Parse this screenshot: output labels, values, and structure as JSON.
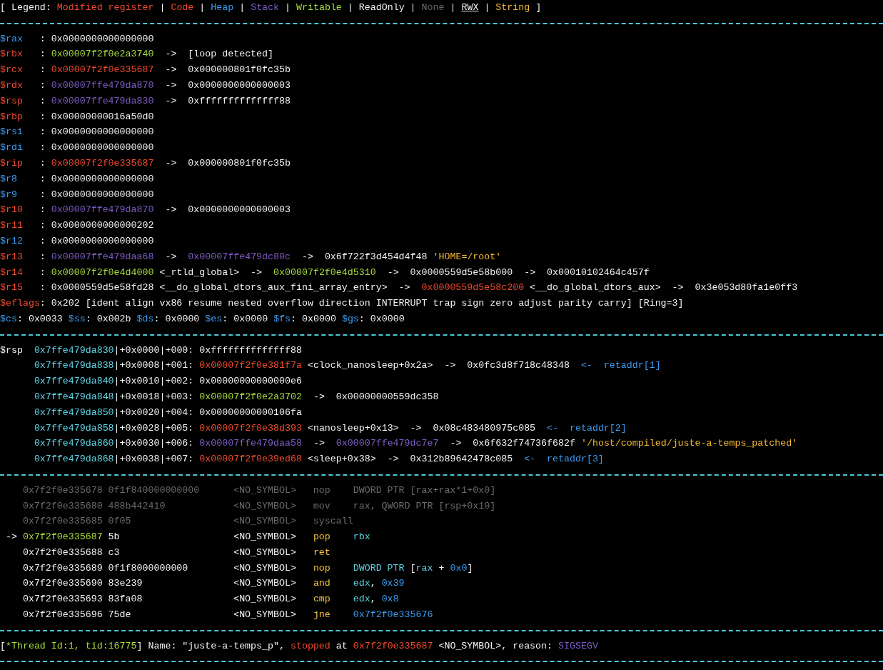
{
  "terminal": {
    "lines": [
      {
        "kind": "text",
        "segments": [
          {
            "kind": "plain",
            "text": "[ Legend: "
          },
          {
            "kind": "modified",
            "text": "Modified register"
          },
          {
            "kind": "plain",
            "text": " | "
          },
          {
            "kind": "code",
            "text": "Code"
          },
          {
            "kind": "plain",
            "text": " | "
          },
          {
            "kind": "heap",
            "text": "Heap"
          },
          {
            "kind": "plain",
            "text": " | "
          },
          {
            "kind": "stack",
            "text": "Stack"
          },
          {
            "kind": "plain",
            "text": " | "
          },
          {
            "kind": "writable",
            "text": "Writable"
          },
          {
            "kind": "plain",
            "text": " | ReadOnly | "
          },
          {
            "kind": "none",
            "text": "None"
          },
          {
            "kind": "plain",
            "text": " | "
          },
          {
            "kind": "rwx",
            "text": "RWX"
          },
          {
            "kind": "plain",
            "text": " | "
          },
          {
            "kind": "string",
            "text": "String"
          },
          {
            "kind": "plain",
            "text": " ]"
          }
        ]
      },
      {
        "kind": "separator"
      },
      {
        "kind": "text",
        "segments": [
          {
            "kind": "heap",
            "text": "$rax"
          },
          {
            "kind": "plain",
            "text": "   : 0x0000000000000000"
          }
        ]
      },
      {
        "kind": "text",
        "segments": [
          {
            "kind": "modified",
            "text": "$rbx"
          },
          {
            "kind": "plain",
            "text": "   : "
          },
          {
            "kind": "writable",
            "text": "0x00007f2f0e2a3740"
          },
          {
            "kind": "plain",
            "text": "  ->  [loop detected]"
          }
        ]
      },
      {
        "kind": "text",
        "segments": [
          {
            "kind": "modified",
            "text": "$rcx"
          },
          {
            "kind": "plain",
            "text": "   : "
          },
          {
            "kind": "code",
            "text": "0x00007f2f0e335687"
          },
          {
            "kind": "plain",
            "text": "  ->  0x000000801f0fc35b"
          }
        ]
      },
      {
        "kind": "text",
        "segments": [
          {
            "kind": "modified",
            "text": "$rdx"
          },
          {
            "kind": "plain",
            "text": "   : "
          },
          {
            "kind": "stack",
            "text": "0x00007ffe479da870"
          },
          {
            "kind": "plain",
            "text": "  ->  0x0000000000000003"
          }
        ]
      },
      {
        "kind": "text",
        "segments": [
          {
            "kind": "modified",
            "text": "$rsp"
          },
          {
            "kind": "plain",
            "text": "   : "
          },
          {
            "kind": "stack",
            "text": "0x00007ffe479da830"
          },
          {
            "kind": "plain",
            "text": "  ->  0xffffffffffffff88"
          }
        ]
      },
      {
        "kind": "text",
        "segments": [
          {
            "kind": "modified",
            "text": "$rbp"
          },
          {
            "kind": "plain",
            "text": "   : 0x00000000016a50d0"
          }
        ]
      },
      {
        "kind": "text",
        "segments": [
          {
            "kind": "heap",
            "text": "$rsi"
          },
          {
            "kind": "plain",
            "text": "   : 0x0000000000000000"
          }
        ]
      },
      {
        "kind": "text",
        "segments": [
          {
            "kind": "heap",
            "text": "$rdi"
          },
          {
            "kind": "plain",
            "text": "   : 0x0000000000000000"
          }
        ]
      },
      {
        "kind": "text",
        "segments": [
          {
            "kind": "modified",
            "text": "$rip"
          },
          {
            "kind": "plain",
            "text": "   : "
          },
          {
            "kind": "code",
            "text": "0x00007f2f0e335687"
          },
          {
            "kind": "plain",
            "text": "  ->  0x000000801f0fc35b"
          }
        ]
      },
      {
        "kind": "text",
        "segments": [
          {
            "kind": "heap",
            "text": "$r8"
          },
          {
            "kind": "plain",
            "text": "    : 0x0000000000000000"
          }
        ]
      },
      {
        "kind": "text",
        "segments": [
          {
            "kind": "heap",
            "text": "$r9"
          },
          {
            "kind": "plain",
            "text": "    : 0x0000000000000000"
          }
        ]
      },
      {
        "kind": "text",
        "segments": [
          {
            "kind": "modified",
            "text": "$r10"
          },
          {
            "kind": "plain",
            "text": "   : "
          },
          {
            "kind": "stack",
            "text": "0x00007ffe479da870"
          },
          {
            "kind": "plain",
            "text": "  ->  0x0000000000000003"
          }
        ]
      },
      {
        "kind": "text",
        "segments": [
          {
            "kind": "modified",
            "text": "$r11"
          },
          {
            "kind": "plain",
            "text": "   : 0x0000000000000202"
          }
        ]
      },
      {
        "kind": "text",
        "segments": [
          {
            "kind": "heap",
            "text": "$r12"
          },
          {
            "kind": "plain",
            "text": "   : 0x0000000000000000"
          }
        ]
      },
      {
        "kind": "text",
        "segments": [
          {
            "kind": "modified",
            "text": "$r13"
          },
          {
            "kind": "plain",
            "text": "   : "
          },
          {
            "kind": "stack",
            "text": "0x00007ffe479daa68"
          },
          {
            "kind": "plain",
            "text": "  ->  "
          },
          {
            "kind": "stack",
            "text": "0x00007ffe479dc80c"
          },
          {
            "kind": "plain",
            "text": "  ->  0x6f722f3d454d4f48 "
          },
          {
            "kind": "string",
            "text": "'HOME=/root'"
          }
        ]
      },
      {
        "kind": "text",
        "segments": [
          {
            "kind": "modified",
            "text": "$r14"
          },
          {
            "kind": "plain",
            "text": "   : "
          },
          {
            "kind": "writable",
            "text": "0x00007f2f0e4d4000"
          },
          {
            "kind": "plain",
            "text": " <_rtld_global>  ->  "
          },
          {
            "kind": "writable",
            "text": "0x00007f2f0e4d5310"
          },
          {
            "kind": "plain",
            "text": "  ->  0x0000559d5e58b000  ->  0x00010102464c457f"
          }
        ]
      },
      {
        "kind": "text",
        "segments": [
          {
            "kind": "modified",
            "text": "$r15"
          },
          {
            "kind": "plain",
            "text": "   : 0x0000559d5e58fd28 <__do_global_dtors_aux_fini_array_entry>  ->  "
          },
          {
            "kind": "code",
            "text": "0x0000559d5e58c200"
          },
          {
            "kind": "plain",
            "text": " <__do_global_dtors_aux>  ->  0x3e053d80fa1e0ff3"
          }
        ]
      },
      {
        "kind": "text",
        "segments": [
          {
            "kind": "modified",
            "text": "$eflags"
          },
          {
            "kind": "plain",
            "text": ": 0x202 [ident align vx86 resume nested overflow direction INTERRUPT trap sign zero adjust parity carry] [Ring=3]"
          }
        ]
      },
      {
        "kind": "text",
        "segments": [
          {
            "kind": "heap",
            "text": "$cs"
          },
          {
            "kind": "plain",
            "text": ": 0x0033 "
          },
          {
            "kind": "heap",
            "text": "$ss"
          },
          {
            "kind": "plain",
            "text": ": 0x002b "
          },
          {
            "kind": "heap",
            "text": "$ds"
          },
          {
            "kind": "plain",
            "text": ": 0x0000 "
          },
          {
            "kind": "heap",
            "text": "$es"
          },
          {
            "kind": "plain",
            "text": ": 0x0000 "
          },
          {
            "kind": "heap",
            "text": "$fs"
          },
          {
            "kind": "plain",
            "text": ": 0x0000 "
          },
          {
            "kind": "heap",
            "text": "$gs"
          },
          {
            "kind": "plain",
            "text": ": 0x0000"
          }
        ]
      },
      {
        "kind": "separator"
      },
      {
        "kind": "text",
        "segments": [
          {
            "kind": "plain",
            "text": "$rsp  "
          },
          {
            "kind": "address",
            "text": "0x7ffe479da830"
          },
          {
            "kind": "plain",
            "text": "|+0x0000|+000: 0xffffffffffffff88"
          }
        ]
      },
      {
        "kind": "stack_row",
        "segments": [
          {
            "kind": "address",
            "text": "0x7ffe479da838"
          },
          {
            "kind": "plain",
            "text": "|+0x0008|+001: "
          },
          {
            "kind": "code",
            "text": "0x00007f2f0e381f7a"
          },
          {
            "kind": "plain",
            "text": " <clock_nanosleep+0x2a>  ->  0x0fc3d8f718c48348  "
          },
          {
            "kind": "heap",
            "text": "<-  retaddr[1]"
          }
        ]
      },
      {
        "kind": "stack_row",
        "segments": [
          {
            "kind": "address",
            "text": "0x7ffe479da840"
          },
          {
            "kind": "plain",
            "text": "|+0x0010|+002: 0x00000000000000e6"
          }
        ]
      },
      {
        "kind": "stack_row",
        "segments": [
          {
            "kind": "address",
            "text": "0x7ffe479da848"
          },
          {
            "kind": "plain",
            "text": "|+0x0018|+003: "
          },
          {
            "kind": "writable",
            "text": "0x00007f2f0e2a3702"
          },
          {
            "kind": "plain",
            "text": "  ->  0x00000000559dc358"
          }
        ]
      },
      {
        "kind": "stack_row",
        "segments": [
          {
            "kind": "address",
            "text": "0x7ffe479da850"
          },
          {
            "kind": "plain",
            "text": "|+0x0020|+004: 0x00000000000106fa"
          }
        ]
      },
      {
        "kind": "stack_row",
        "segments": [
          {
            "kind": "address",
            "text": "0x7ffe479da858"
          },
          {
            "kind": "plain",
            "text": "|+0x0028|+005: "
          },
          {
            "kind": "code",
            "text": "0x00007f2f0e38d393"
          },
          {
            "kind": "plain",
            "text": " <nanosleep+0x13>  ->  0x08c483480975c085  "
          },
          {
            "kind": "heap",
            "text": "<-  retaddr[2]"
          }
        ]
      },
      {
        "kind": "stack_row",
        "segments": [
          {
            "kind": "address",
            "text": "0x7ffe479da860"
          },
          {
            "kind": "plain",
            "text": "|+0x0030|+006: "
          },
          {
            "kind": "stack",
            "text": "0x00007ffe479daa58"
          },
          {
            "kind": "plain",
            "text": "  ->  "
          },
          {
            "kind": "stack",
            "text": "0x00007ffe479dc7e7"
          },
          {
            "kind": "plain",
            "text": "  ->  0x6f632f74736f682f "
          },
          {
            "kind": "string",
            "text": "'/host/compiled/juste-a-temps_patched'"
          }
        ]
      },
      {
        "kind": "stack_row",
        "segments": [
          {
            "kind": "address",
            "text": "0x7ffe479da868"
          },
          {
            "kind": "plain",
            "text": "|+0x0038|+007: "
          },
          {
            "kind": "code",
            "text": "0x00007f2f0e39ed68"
          },
          {
            "kind": "plain",
            "text": " <sleep+0x38>  ->  0x312b89642478c085  "
          },
          {
            "kind": "heap",
            "text": "<-  retaddr[3]"
          }
        ]
      },
      {
        "kind": "separator"
      },
      {
        "kind": "code_row",
        "segments": [
          {
            "kind": "dim",
            "text": "0x7f2f0e335678 0f1f840000000000      <NO_SYMBOL>   nop    DWORD PTR [rax+rax*1+0x0]"
          }
        ]
      },
      {
        "kind": "code_row",
        "segments": [
          {
            "kind": "dim",
            "text": "0x7f2f0e335680 488b442410            <NO_SYMBOL>   mov    rax, QWORD PTR [rsp+0x10]"
          }
        ]
      },
      {
        "kind": "code_row",
        "segments": [
          {
            "kind": "dim",
            "text": "0x7f2f0e335685 0f05                  <NO_SYMBOL>   syscall"
          }
        ]
      },
      {
        "kind": "text",
        "segments": [
          {
            "kind": "plain",
            "text": " -> "
          },
          {
            "kind": "writable",
            "text": "0x7f2f0e335687"
          },
          {
            "kind": "plain",
            "text": " 5b                    <NO_SYMBOL>   "
          },
          {
            "kind": "mnemonic",
            "text": "pop"
          },
          {
            "kind": "operand",
            "text": "rbx"
          }
        ]
      },
      {
        "kind": "text",
        "segments": [
          {
            "kind": "plain",
            "text": "    0x7f2f0e335688 c3                    <NO_SYMBOL>   "
          },
          {
            "kind": "mnemonic",
            "text": "ret"
          }
        ]
      },
      {
        "kind": "text",
        "segments": [
          {
            "kind": "plain",
            "text": "    0x7f2f0e335689 0f1f8000000000        <NO_SYMBOL>   "
          },
          {
            "kind": "mnemonic",
            "text": "nop"
          },
          {
            "kind": "operand",
            "text": "DWORD PTR"
          },
          {
            "kind": "plain",
            "text": " ["
          },
          {
            "kind": "operand",
            "text": "rax"
          },
          {
            "kind": "plain",
            "text": " + "
          },
          {
            "kind": "heap",
            "text": "0x0"
          },
          {
            "kind": "plain",
            "text": "]"
          }
        ]
      },
      {
        "kind": "text",
        "segments": [
          {
            "kind": "plain",
            "text": "    0x7f2f0e335690 83e239                <NO_SYMBOL>   "
          },
          {
            "kind": "mnemonic",
            "text": "and"
          },
          {
            "kind": "operand",
            "text": "edx"
          },
          {
            "kind": "plain",
            "text": ", "
          },
          {
            "kind": "heap",
            "text": "0x39"
          }
        ]
      },
      {
        "kind": "text",
        "segments": [
          {
            "kind": "plain",
            "text": "    0x7f2f0e335693 83fa08                <NO_SYMBOL>   "
          },
          {
            "kind": "mnemonic",
            "text": "cmp"
          },
          {
            "kind": "operand",
            "text": "edx"
          },
          {
            "kind": "plain",
            "text": ", "
          },
          {
            "kind": "heap",
            "text": "0x8"
          }
        ]
      },
      {
        "kind": "text",
        "segments": [
          {
            "kind": "plain",
            "text": "    0x7f2f0e335696 75de                  <NO_SYMBOL>   "
          },
          {
            "kind": "mnemonic",
            "text": "jne"
          },
          {
            "kind": "heap",
            "text": "0x7f2f0e335676"
          }
        ]
      },
      {
        "kind": "separator"
      },
      {
        "kind": "text",
        "segments": [
          {
            "kind": "plain",
            "text": "["
          },
          {
            "kind": "writable",
            "text": "*Thread Id:1, tid:16775"
          },
          {
            "kind": "plain",
            "text": "] Name: \"juste-a-temps_p\", "
          },
          {
            "kind": "code",
            "text": "stopped"
          },
          {
            "kind": "plain",
            "text": " at "
          },
          {
            "kind": "code",
            "text": "0x7f2f0e335687"
          },
          {
            "kind": "plain",
            "text": " <NO_SYMBOL>, reason: "
          },
          {
            "kind": "stack",
            "text": "SIGSEGV"
          }
        ]
      },
      {
        "kind": "separator"
      }
    ]
  }
}
